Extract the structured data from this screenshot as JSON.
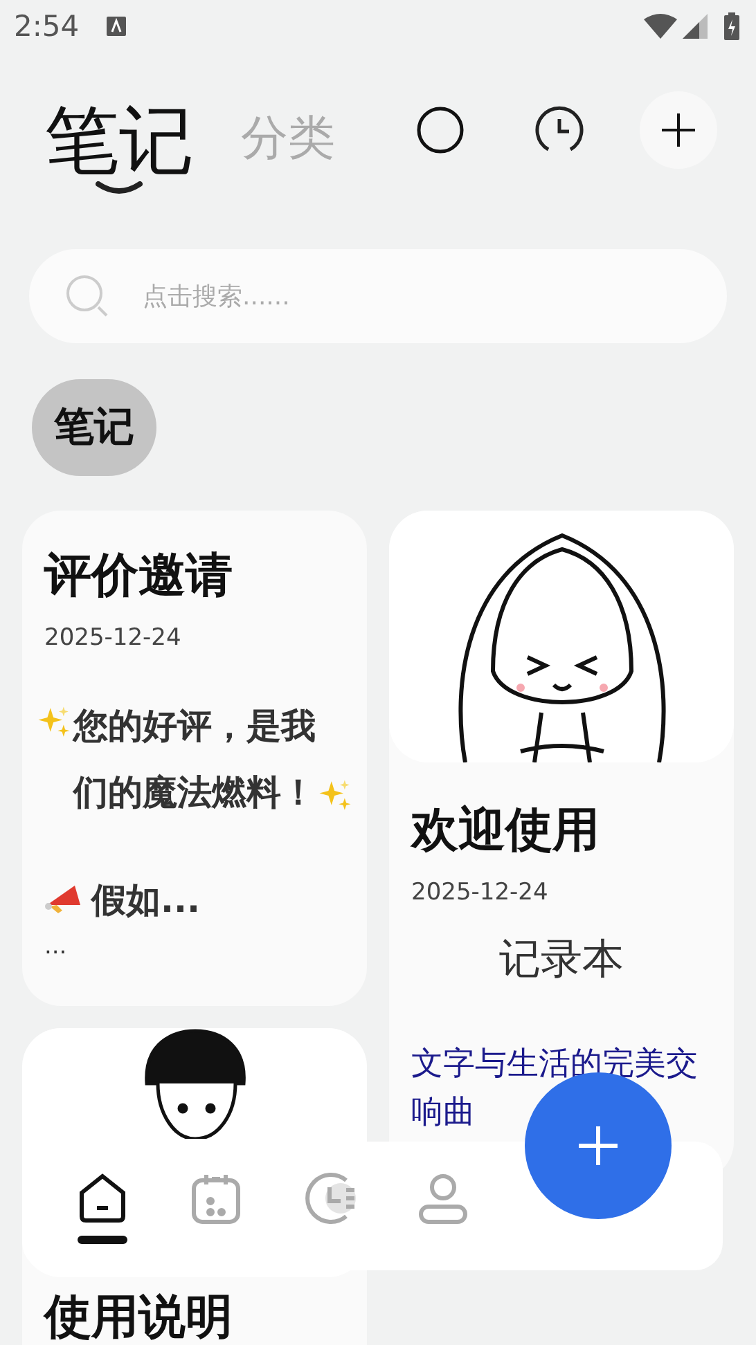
{
  "status_bar": {
    "time": "2:54"
  },
  "header": {
    "tabs": [
      {
        "label": "笔记",
        "selected": true
      },
      {
        "label": "分类",
        "selected": false
      }
    ]
  },
  "search": {
    "placeholder": "点击搜索......"
  },
  "filters": [
    {
      "label": "笔记",
      "selected": true
    }
  ],
  "columns": [
    {
      "notes": [
        {
          "kind": "text",
          "title": "评价邀请",
          "date": "2025-12-24",
          "body": [
            {
              "kind": "highlight",
              "text": "您的好评，是我们的魔法燃料！"
            },
            {
              "kind": "lead",
              "text": "假如..."
            },
            {
              "kind": "plain",
              "text": "..."
            }
          ]
        },
        {
          "kind": "image",
          "title": "使用说明"
        }
      ]
    },
    {
      "notes": [
        {
          "kind": "image",
          "title": "欢迎使用",
          "date": "2025-12-24",
          "body": [
            {
              "kind": "heading",
              "text": "记录本"
            },
            {
              "kind": "link",
              "text": "文字与生活的完美交响曲"
            }
          ]
        }
      ]
    }
  ],
  "nav": {
    "items": [
      {
        "selected": true
      },
      {
        "selected": false
      },
      {
        "selected": false
      },
      {
        "selected": false
      }
    ]
  }
}
